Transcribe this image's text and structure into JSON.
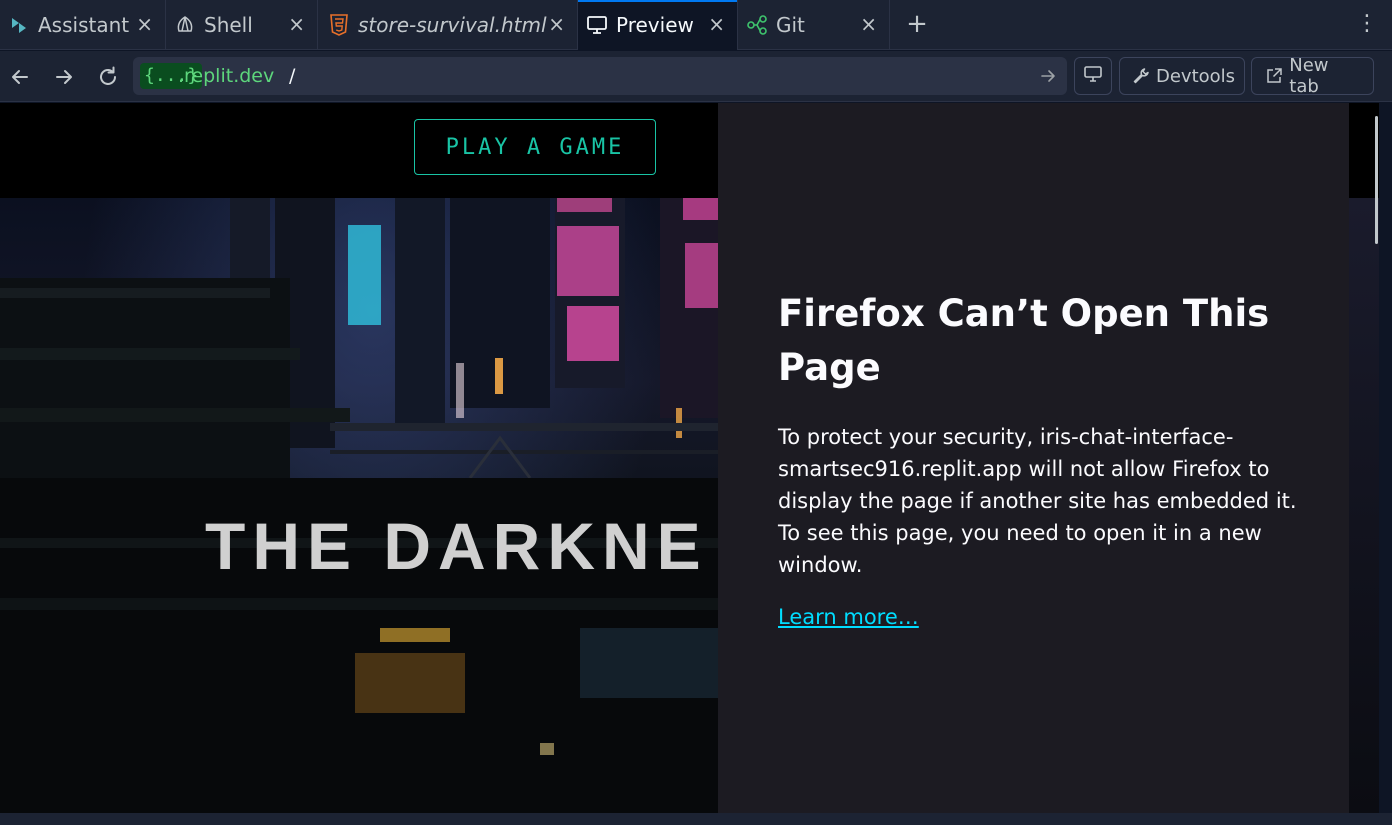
{
  "tabs": [
    {
      "label": "Assistant",
      "icon": "assistant-icon"
    },
    {
      "label": "Shell",
      "icon": "shell-icon"
    },
    {
      "label": "store-survival.html",
      "icon": "html5-icon"
    },
    {
      "label": "Preview",
      "icon": "monitor-icon",
      "active": true
    },
    {
      "label": "Git",
      "icon": "git-icon"
    }
  ],
  "tab_close_glyph": "×",
  "tab_add_glyph": "+",
  "tab_menu_glyph": "⋮",
  "address": {
    "badge": "{...}",
    "host": ".replit.dev",
    "path": "/"
  },
  "toolbar": {
    "devtools_label": "Devtools",
    "new_tab_label": "New tab"
  },
  "site": {
    "play_button": "PLAY A GAME",
    "hero_title": "THE DARKNE"
  },
  "error": {
    "title": "Firefox Can’t Open This Page",
    "body": "To protect your security, iris-chat-interface-smartsec916.replit.app will not allow Firefox to display the page if another site has embedded it. To see this page, you need to open it in a new window.",
    "link": "Learn more…"
  },
  "colors": {
    "accent": "#0079f2",
    "url_green": "#5dd67c",
    "play_teal": "#19c4a5",
    "link_cyan": "#00ddff"
  }
}
